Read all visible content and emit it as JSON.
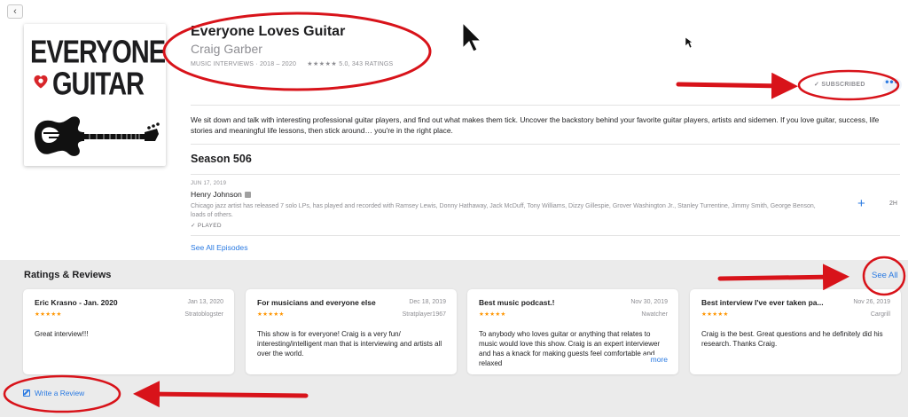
{
  "nav": {
    "back_glyph": "‹"
  },
  "cover": {
    "line1": "EVERYONE",
    "line2": "GUITAR",
    "heart_color": "#d8262a"
  },
  "podcast": {
    "title": "Everyone Loves Guitar",
    "author": "Craig Garber",
    "meta": "MUSIC INTERVIEWS · 2018 – 2020",
    "rating_stars": "★★★★★",
    "rating_text": "5.0, 343 RATINGS",
    "subscribe_label": "✓ SUBSCRIBED",
    "more_label": "•••",
    "description": "We sit down and talk with interesting professional guitar players, and find out what makes them tick. Uncover the backstory behind your favorite guitar players, artists and sidemen. If you love guitar, success, life stories and meaningful life lessons, then stick around… you're in the right place."
  },
  "season": {
    "label": "Season 506"
  },
  "episode": {
    "date": "JUN 17, 2019",
    "title": "Henry Johnson",
    "description": "Chicago jazz artist has released 7 solo LPs, has played and recorded with Ramsey Lewis, Donny Hathaway, Jack McDuff, Tony Williams, Dizzy Gillespie,  Grover Washington Jr., Stanley Turrentine, Jimmy Smith, George Benson, loads of others.",
    "played_label": "✓ PLAYED",
    "add_label": "+",
    "duration": "2H"
  },
  "see_all_episodes": "See All Episodes",
  "reviews": {
    "heading": "Ratings & Reviews",
    "see_all": "See All",
    "write_review": "Write a Review",
    "items": [
      {
        "title": "Eric Krasno - Jan. 2020",
        "date": "Jan 13, 2020",
        "stars": "★★★★★",
        "author": "Stratoblogster",
        "body": "Great interview!!!"
      },
      {
        "title": "For musicians and everyone else",
        "date": "Dec 18, 2019",
        "stars": "★★★★★",
        "author": "Stratplayer1967",
        "body": "This show is for everyone! Craig is a very fun/ interesting/intelligent man that is interviewing and artists all over the world."
      },
      {
        "title": "Best music podcast.!",
        "date": "Nov 30, 2019",
        "stars": "★★★★★",
        "author": "Nwatcher",
        "body": "To anybody who loves guitar or anything that relates to music would love this show. Craig is an expert interviewer and has a knack for making guests feel comfortable and relaxed",
        "more": "more"
      },
      {
        "title": "Best interview I've ever taken pa...",
        "date": "Nov 26, 2019",
        "stars": "★★★★★",
        "author": "Cargrill",
        "body": "Craig is the best. Great questions and he definitely did his research. Thanks Craig."
      }
    ]
  },
  "colors": {
    "accent": "#2a7ae2",
    "annotation_red": "#d8131a",
    "star_orange": "#ff9500"
  }
}
